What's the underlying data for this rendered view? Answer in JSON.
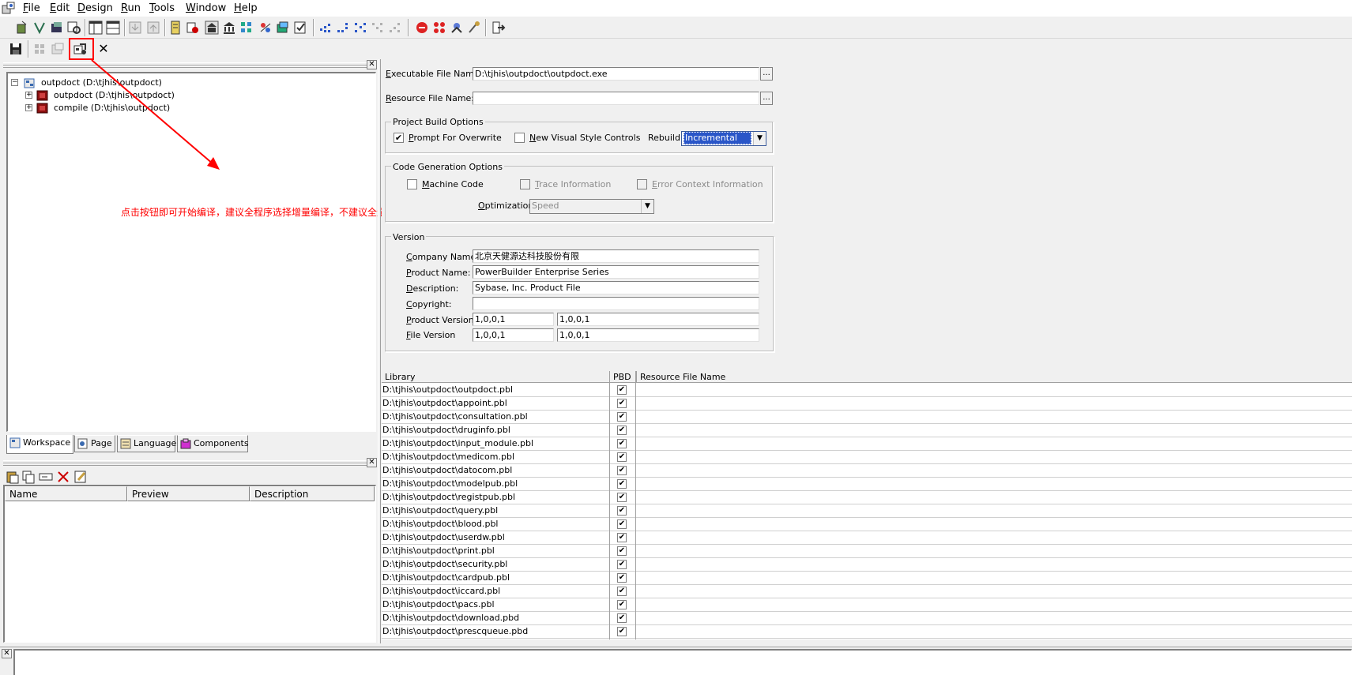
{
  "menubar": {
    "items": [
      "File",
      "Edit",
      "Design",
      "Run",
      "Tools",
      "Window",
      "Help"
    ]
  },
  "toolbar": {
    "icons": [
      "new-icon",
      "inherit-icon",
      "open-icon",
      "search-icon",
      "layout-window-icon",
      "layout-panes-icon",
      "import-icon",
      "export-icon",
      "library-painter-icon",
      "database-icon",
      "dbprofile-icon",
      "object-browser-icon",
      "application-icon",
      "dbtools-icon",
      "todo-list-icon",
      "build-icon",
      "incremental-build-icon",
      "full-build-icon",
      "debug-icon",
      "stop-icon",
      "debugger-icon",
      "run-icon",
      "profiler-icon",
      "exit-icon"
    ],
    "second_row": [
      "save-icon",
      "project-icon",
      "migrate-icon",
      "deploy-icon",
      "close-icon"
    ]
  },
  "tree": {
    "root": "outpdoct (D:\\tjhis\\outpdoct)",
    "children": [
      "outpdoct (D:\\tjhis\\outpdoct)",
      "compile (D:\\tjhis\\outpdoct)"
    ]
  },
  "annotation": {
    "text": "点击按钮即可开始编译，建议全程序选择增量编译，不建议全量。",
    "color": "#ff0000"
  },
  "tabs": [
    "Workspace",
    "Page",
    "Language",
    "Components"
  ],
  "clip_panel": {
    "columns": [
      "Name",
      "Preview",
      "Description"
    ]
  },
  "project": {
    "exe_label": "Executable File Name:",
    "exe_value": "D:\\tjhis\\outpdoct\\outpdoct.exe",
    "res_label": "Resource File Name:",
    "res_value": "",
    "browse": "...",
    "build_group": "Project Build Options",
    "prompt_overwrite": "Prompt For Overwrite",
    "prompt_overwrite_checked": "✔",
    "new_visual": "New Visual Style Controls",
    "rebuild_label": "Rebuild:",
    "rebuild_value": "Incremental",
    "codegen_group": "Code Generation Options",
    "machine_code": "Machine Code",
    "trace_info": "Trace Information",
    "error_context": "Error Context Information",
    "optimization_label": "Optimization:",
    "optimization_value": "Speed",
    "version_group": "Version",
    "company_label": "Company Name:",
    "company_value": "北京天健源达科技股份有限",
    "product_label": "Product Name:",
    "product_value": "PowerBuilder Enterprise Series",
    "description_label": "Description:",
    "description_value": "Sybase, Inc. Product File",
    "copyright_label": "Copyright:",
    "copyright_value": "",
    "product_version_label": "Product Version:",
    "product_version_1": "1,0,0,1",
    "product_version_2": "1,0,0,1",
    "file_version_label": "File Version",
    "file_version_1": "1,0,0,1",
    "file_version_2": "1,0,0,1"
  },
  "library_grid": {
    "headers": [
      "Library",
      "PBD",
      "Resource File Name"
    ],
    "rows": [
      "D:\\tjhis\\outpdoct\\outpdoct.pbl",
      "D:\\tjhis\\outpdoct\\appoint.pbl",
      "D:\\tjhis\\outpdoct\\consultation.pbl",
      "D:\\tjhis\\outpdoct\\druginfo.pbl",
      "D:\\tjhis\\outpdoct\\input_module.pbl",
      "D:\\tjhis\\outpdoct\\medicom.pbl",
      "D:\\tjhis\\outpdoct\\datocom.pbl",
      "D:\\tjhis\\outpdoct\\modelpub.pbl",
      "D:\\tjhis\\outpdoct\\registpub.pbl",
      "D:\\tjhis\\outpdoct\\query.pbl",
      "D:\\tjhis\\outpdoct\\blood.pbl",
      "D:\\tjhis\\outpdoct\\userdw.pbl",
      "D:\\tjhis\\outpdoct\\print.pbl",
      "D:\\tjhis\\outpdoct\\security.pbl",
      "D:\\tjhis\\outpdoct\\cardpub.pbl",
      "D:\\tjhis\\outpdoct\\iccard.pbl",
      "D:\\tjhis\\outpdoct\\pacs.pbl",
      "D:\\tjhis\\outpdoct\\download.pbd",
      "D:\\tjhis\\outpdoct\\prescqueue.pbd"
    ],
    "pbd_mark": "✔"
  },
  "panel_close": "✕"
}
